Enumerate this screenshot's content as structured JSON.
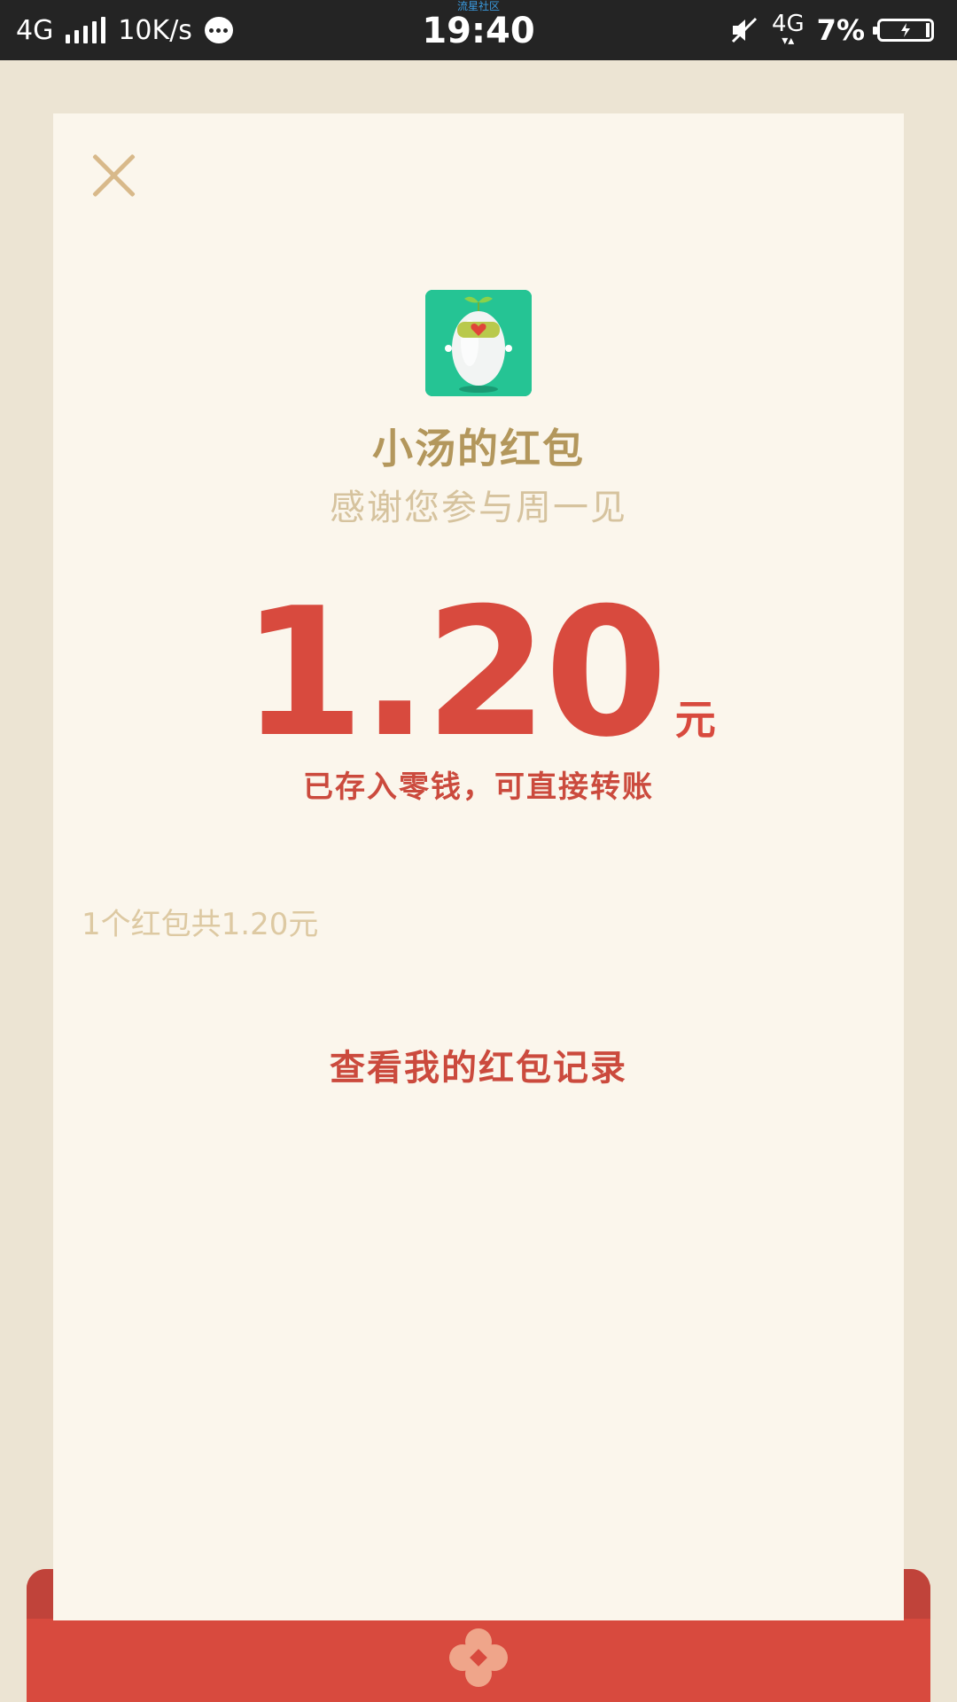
{
  "status_bar": {
    "network_left": "4G",
    "speed": "10K/s",
    "carrier_text": "流星社区",
    "time": "19:40",
    "network_right": "4G",
    "battery": "7%"
  },
  "icons": {
    "close": "close-icon",
    "avatar": "app-avatar-icon",
    "decoration": "flower-icon"
  },
  "colors": {
    "accent_red": "#d84a3e",
    "gold": "#b3975c",
    "card_bg": "#fbf6ec",
    "page_bg": "#ece4d3",
    "avatar_green": "#25c494"
  },
  "red_packet": {
    "sender": "小汤的红包",
    "greeting": "感谢您参与周一见",
    "amount": "1.20",
    "unit": "元",
    "saved_note": "已存入零钱，可直接转账",
    "summary": "1个红包共1.20元",
    "records_link": "查看我的红包记录"
  }
}
